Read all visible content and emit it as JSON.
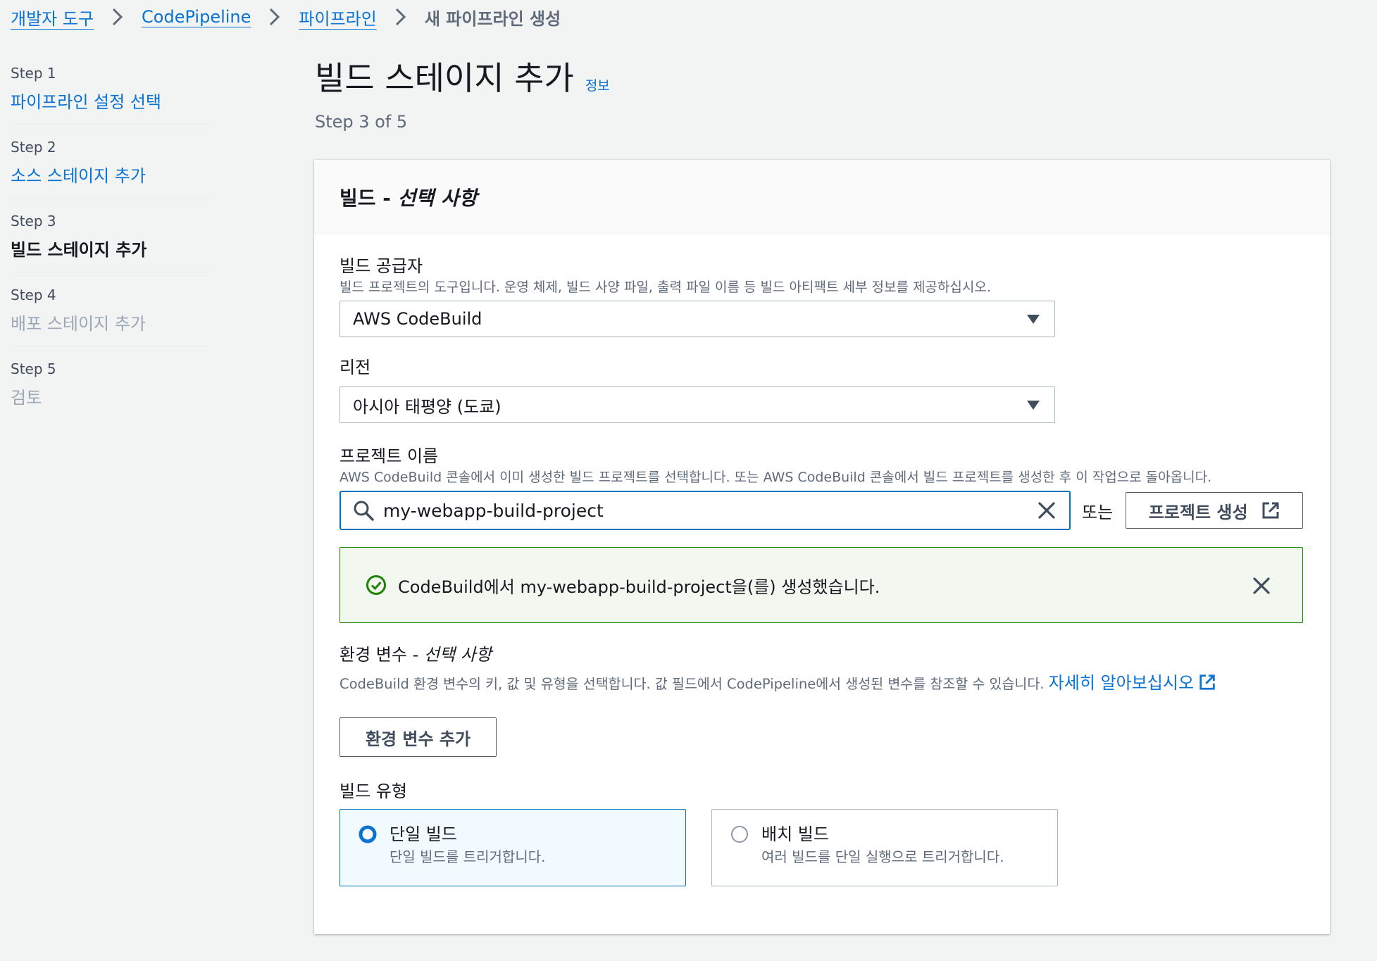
{
  "breadcrumb": {
    "items": [
      "개발자 도구",
      "CodePipeline",
      "파이프라인"
    ],
    "current": "새 파이프라인 생성"
  },
  "steps": [
    {
      "num": "Step 1",
      "label": "파이프라인 설정 선택",
      "state": "link"
    },
    {
      "num": "Step 2",
      "label": "소스 스테이지 추가",
      "state": "link"
    },
    {
      "num": "Step 3",
      "label": "빌드 스테이지 추가",
      "state": "active"
    },
    {
      "num": "Step 4",
      "label": "배포 스테이지 추가",
      "state": "disabled"
    },
    {
      "num": "Step 5",
      "label": "검토",
      "state": "disabled"
    }
  ],
  "page": {
    "title": "빌드 스테이지 추가",
    "info_link": "정보",
    "step_of": "Step 3 of 5"
  },
  "container": {
    "title_main": "빌드 - ",
    "title_optional": "선택 사항"
  },
  "build_provider": {
    "label": "빌드 공급자",
    "description": "빌드 프로젝트의 도구입니다. 운영 체제, 빌드 사양 파일, 출력 파일 이름 등 빌드 아티팩트 세부 정보를 제공하십시오.",
    "value": "AWS CodeBuild"
  },
  "region": {
    "label": "리전",
    "value": "아시아 태평양 (도쿄)"
  },
  "project_name": {
    "label": "프로젝트 이름",
    "description": "AWS CodeBuild 콘솔에서 이미 생성한 빌드 프로젝트를 선택합니다. 또는 AWS CodeBuild 콘솔에서 빌드 프로젝트를 생성한 후 이 작업으로 돌아옵니다.",
    "value": "my-webapp-build-project",
    "or_text": "또는",
    "create_button": "프로젝트 생성"
  },
  "alert": {
    "text": "CodeBuild에서 my-webapp-build-project을(를) 생성했습니다."
  },
  "env_vars": {
    "label_main": "환경 변수 - ",
    "label_optional": "선택 사항",
    "description": "CodeBuild 환경 변수의 키, 값 및 유형을 선택합니다. 값 필드에서 CodePipeline에서 생성된 변수를 참조할 수 있습니다. ",
    "learn_more": "자세히 알아보십시오",
    "add_button": "환경 변수 추가"
  },
  "build_type": {
    "label": "빌드 유형",
    "options": [
      {
        "label": "단일 빌드",
        "description": "단일 빌드를 트리거합니다.",
        "selected": true
      },
      {
        "label": "배치 빌드",
        "description": "여러 빌드를 단일 실행으로 트리거합니다.",
        "selected": false
      }
    ]
  },
  "colors": {
    "link": "#0972d3",
    "success": "#1d8102",
    "focus_border": "#0073bb",
    "page_bg": "#f2f3f3"
  }
}
